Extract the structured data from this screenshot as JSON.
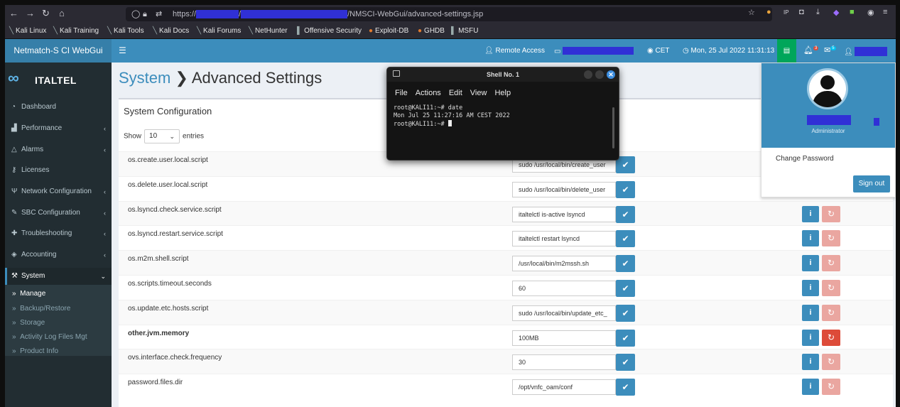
{
  "browser": {
    "url_prefix": "https://",
    "url_sep": "/",
    "url_path": "/NMSCI-WebGui/advanced-settings.jsp",
    "bookmarks": [
      "Kali Linux",
      "Kali Training",
      "Kali Tools",
      "Kali Docs",
      "Kali Forums",
      "NetHunter",
      "Offensive Security",
      "Exploit-DB",
      "GHDB",
      "MSFU"
    ]
  },
  "header": {
    "brand": "Netmatch-S CI WebGui",
    "remote_access": "Remote Access",
    "timezone": "CET",
    "datetime": "Mon, 25 Jul 2022 11:31:13",
    "notif_count": "3",
    "mail_count": "5"
  },
  "sidebar": {
    "logo_text": "ITALTEL",
    "items": [
      {
        "label": "Dashboard",
        "icon": "dashboard-icon"
      },
      {
        "label": "Performance",
        "icon": "bar-chart-icon"
      },
      {
        "label": "Alarms",
        "icon": "alarm-icon"
      },
      {
        "label": "Licenses",
        "icon": "key-icon"
      },
      {
        "label": "Network Configuration",
        "icon": "network-icon"
      },
      {
        "label": "SBC Configuration",
        "icon": "edit-icon"
      },
      {
        "label": "Troubleshooting",
        "icon": "ambulance-icon"
      },
      {
        "label": "Accounting",
        "icon": "tag-icon"
      },
      {
        "label": "System",
        "icon": "wrench-icon"
      }
    ],
    "submenu": [
      "Manage",
      "Backup/Restore",
      "Storage",
      "Activity Log Files Mgt",
      "Product Info"
    ]
  },
  "page": {
    "breadcrumb_root": "System",
    "breadcrumb_current": "Advanced Settings",
    "box_title": "System Configuration",
    "show_label": "Show",
    "entries_value": "10",
    "entries_label": "entries"
  },
  "settings": [
    {
      "key": "os.create.user.local.script",
      "value": "sudo /usr/local/bin/create_user"
    },
    {
      "key": "os.delete.user.local.script",
      "value": "sudo /usr/local/bin/delete_user"
    },
    {
      "key": "os.lsyncd.check.service.script",
      "value": "italtelctl is-active lsyncd"
    },
    {
      "key": "os.lsyncd.restart.service.script",
      "value": "italtelctl restart lsyncd"
    },
    {
      "key": "os.m2m.shell.script",
      "value": "/usr/local/bin/m2mssh.sh"
    },
    {
      "key": "os.scripts.timeout.seconds",
      "value": "60"
    },
    {
      "key": "os.update.etc.hosts.script",
      "value": "sudo /usr/local/bin/update_etc_"
    },
    {
      "key": "other.jvm.memory",
      "value": "100MB"
    },
    {
      "key": "ovs.interface.check.frequency",
      "value": "30"
    },
    {
      "key": "password.files.dir",
      "value": "/opt/vnfc_oam/conf"
    }
  ],
  "user_menu": {
    "role": "Administrator",
    "change_password": "Change Password",
    "sign_out": "Sign out"
  },
  "terminal": {
    "title": "Shell No. 1",
    "menu": [
      "File",
      "Actions",
      "Edit",
      "View",
      "Help"
    ],
    "lines": [
      "root@KALI11:~# date",
      "Mon Jul 25 11:27:16 AM CEST 2022",
      "root@KALI11:~# "
    ]
  },
  "colors": {
    "header": "#3c8dbc",
    "sidebar": "#222d32",
    "reset_active": "#dd4b39",
    "redaction": "#3030d6"
  }
}
